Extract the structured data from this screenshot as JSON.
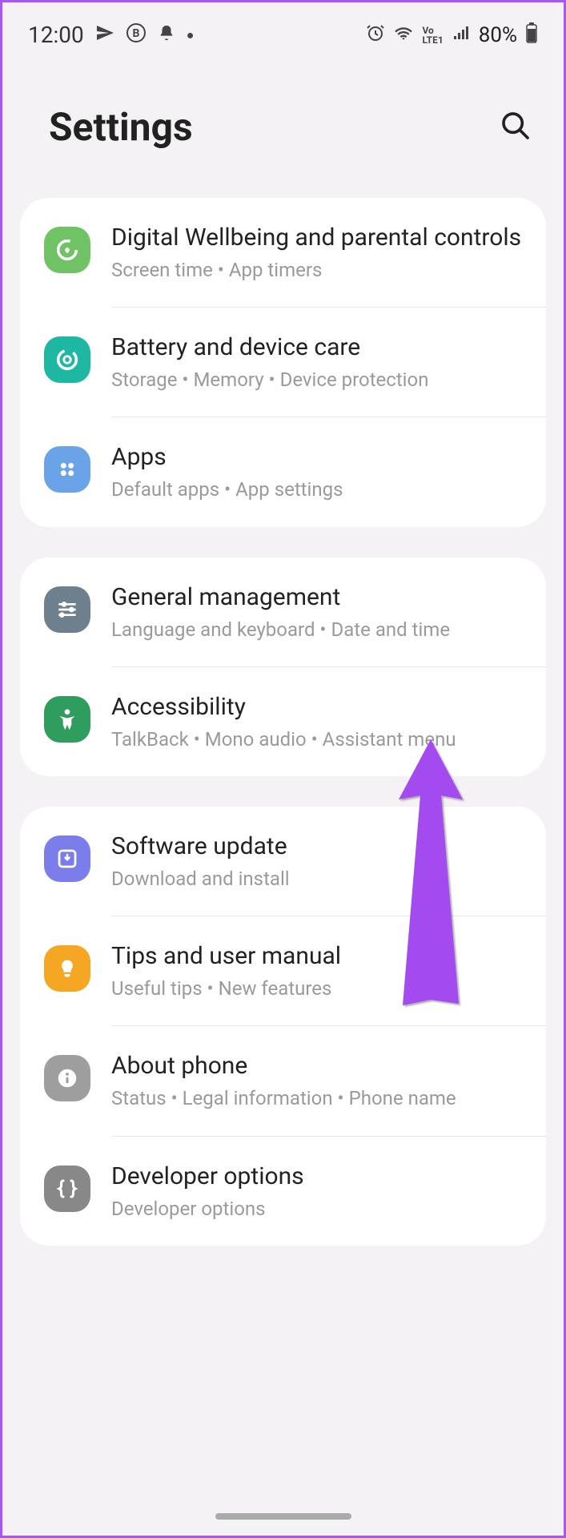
{
  "status_bar": {
    "time": "12:00",
    "battery": "80%"
  },
  "header": {
    "title": "Settings"
  },
  "groups": [
    {
      "items": [
        {
          "id": "wellbeing",
          "title": "Digital Wellbeing and parental controls",
          "sub": "Screen time  •  App timers",
          "color": "#6fc364"
        },
        {
          "id": "battery",
          "title": "Battery and device care",
          "sub": "Storage  •  Memory  •  Device protection",
          "color": "#1eb8a2"
        },
        {
          "id": "apps",
          "title": "Apps",
          "sub": "Default apps  •  App settings",
          "color": "#6aa3e8"
        }
      ]
    },
    {
      "items": [
        {
          "id": "general",
          "title": "General management",
          "sub": "Language and keyboard  •  Date and time",
          "color": "#6e7f8d"
        },
        {
          "id": "accessibility",
          "title": "Accessibility",
          "sub": "TalkBack  •  Mono audio  •  Assistant menu",
          "color": "#2f9d5e"
        }
      ]
    },
    {
      "items": [
        {
          "id": "update",
          "title": "Software update",
          "sub": "Download and install",
          "color": "#7a7dea"
        },
        {
          "id": "tips",
          "title": "Tips and user manual",
          "sub": "Useful tips  •  New features",
          "color": "#f5a623"
        },
        {
          "id": "about",
          "title": "About phone",
          "sub": "Status  •  Legal information  •  Phone name",
          "color": "#9e9e9e"
        },
        {
          "id": "developer",
          "title": "Developer options",
          "sub": "Developer options",
          "color": "#888"
        }
      ]
    }
  ]
}
